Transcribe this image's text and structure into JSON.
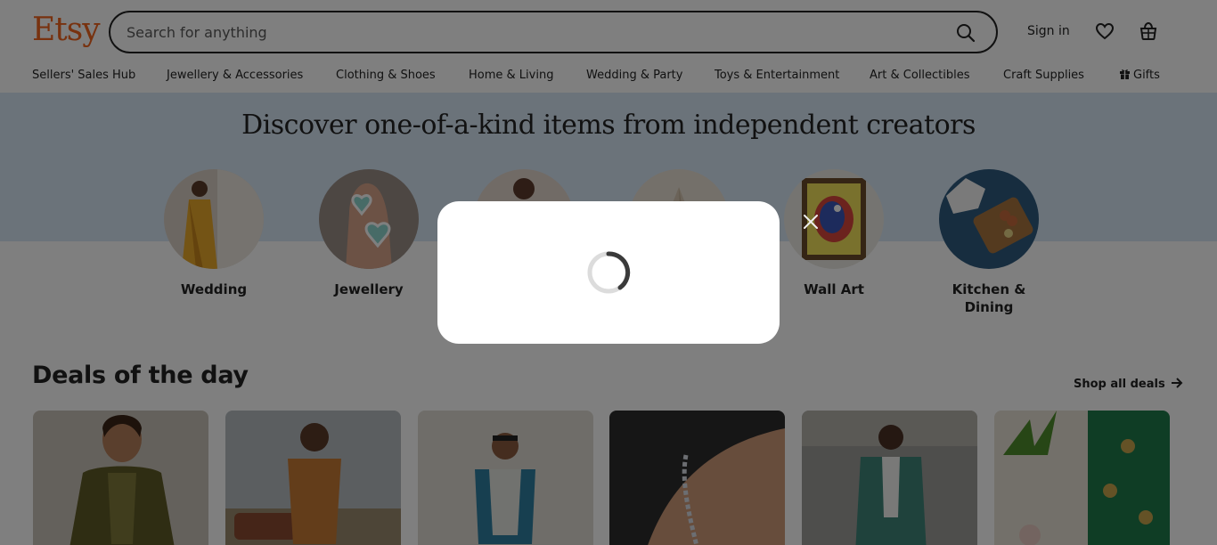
{
  "header": {
    "logo": "Etsy",
    "search_placeholder": "Search for anything",
    "sign_in": "Sign in",
    "icons": [
      "search-icon",
      "heart-icon",
      "basket-icon"
    ]
  },
  "nav": {
    "items": [
      "Sellers' Sales Hub",
      "Jewellery & Accessories",
      "Clothing & Shoes",
      "Home & Living",
      "Wedding & Party",
      "Toys & Entertainment",
      "Art & Collectibles",
      "Craft Supplies",
      "Gifts"
    ]
  },
  "hero": {
    "title": "Discover one-of-a-kind items from independent creators",
    "categories": [
      "Wedding",
      "Jewellery",
      "",
      "",
      "Wall Art",
      "Kitchen & Dining"
    ]
  },
  "deals": {
    "title": "Deals of the day",
    "shop_all": "Shop all deals"
  },
  "colors": {
    "brand": "#f1641e",
    "hero_band": "#d7e6f5",
    "overlay": "rgba(0,0,0,0.5)"
  },
  "modal": {
    "state": "loading"
  }
}
